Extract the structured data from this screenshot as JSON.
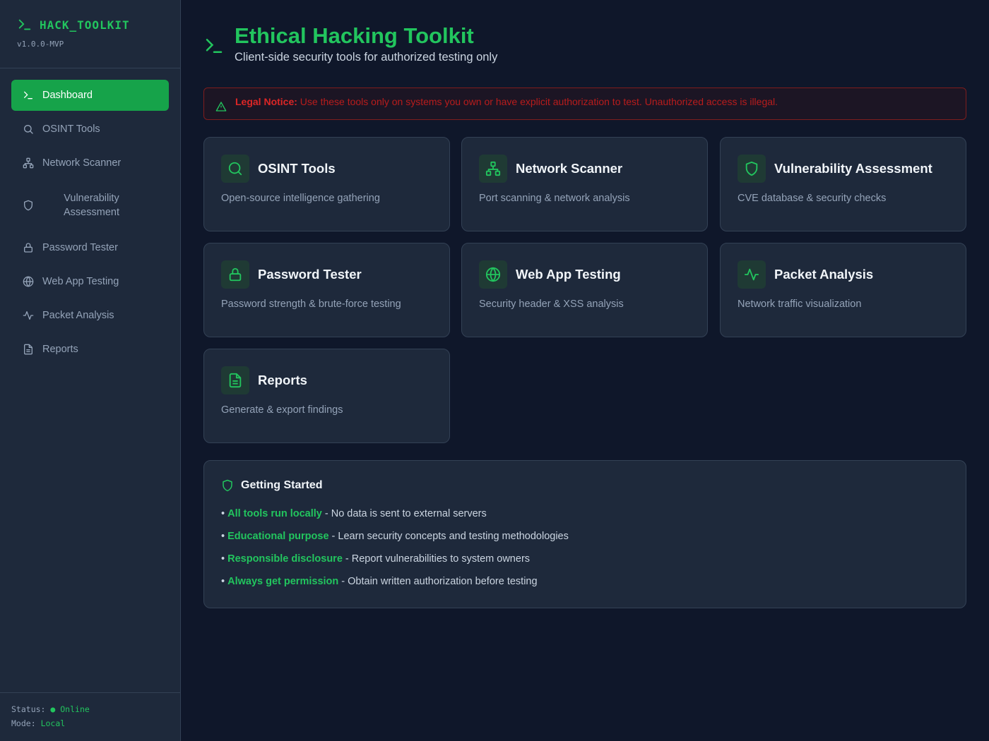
{
  "app": {
    "name": "HACK_TOOLKIT",
    "version": "v1.0.0-MVP"
  },
  "sidebar": {
    "items": [
      {
        "label": "Dashboard",
        "icon": "terminal-icon",
        "active": true
      },
      {
        "label": "OSINT Tools",
        "icon": "search-icon"
      },
      {
        "label": "Network Scanner",
        "icon": "network-icon"
      },
      {
        "label": "Vulnerability Assessment",
        "icon": "shield-icon"
      },
      {
        "label": "Password Tester",
        "icon": "lock-icon"
      },
      {
        "label": "Web App Testing",
        "icon": "globe-icon"
      },
      {
        "label": "Packet Analysis",
        "icon": "activity-icon"
      },
      {
        "label": "Reports",
        "icon": "file-icon"
      }
    ],
    "footer": {
      "status_label": "Status:",
      "status_value": "● Online",
      "mode_label": "Mode:",
      "mode_value": "Local"
    }
  },
  "header": {
    "title": "Ethical Hacking Toolkit",
    "subtitle": "Client-side security tools for authorized testing only"
  },
  "notice": {
    "label": "Legal Notice:",
    "text": "Use these tools only on systems you own or have explicit authorization to test. Unauthorized access is illegal."
  },
  "cards": [
    {
      "title": "OSINT Tools",
      "desc": "Open-source intelligence gathering",
      "icon": "search-icon"
    },
    {
      "title": "Network Scanner",
      "desc": "Port scanning & network analysis",
      "icon": "network-icon"
    },
    {
      "title": "Vulnerability Assessment",
      "desc": "CVE database & security checks",
      "icon": "shield-icon"
    },
    {
      "title": "Password Tester",
      "desc": "Password strength & brute-force testing",
      "icon": "lock-icon"
    },
    {
      "title": "Web App Testing",
      "desc": "Security header & XSS analysis",
      "icon": "globe-icon"
    },
    {
      "title": "Packet Analysis",
      "desc": "Network traffic visualization",
      "icon": "activity-icon"
    },
    {
      "title": "Reports",
      "desc": "Generate & export findings",
      "icon": "file-icon"
    }
  ],
  "getting_started": {
    "title": "Getting Started",
    "items": [
      {
        "bullet": "•",
        "em": "All tools run locally",
        "rest": " - No data is sent to external servers"
      },
      {
        "bullet": "•",
        "em": "Educational purpose",
        "rest": " - Learn security concepts and testing methodologies"
      },
      {
        "bullet": "•",
        "em": "Responsible disclosure",
        "rest": " - Report vulnerabilities to system owners"
      },
      {
        "bullet": "•",
        "em": "Always get permission",
        "rest": " - Obtain written authorization before testing"
      }
    ]
  },
  "colors": {
    "accent": "#22c55e",
    "active_bg": "#16a34a",
    "danger": "#dc2626",
    "bg": "#0f172a",
    "panel": "#1e293b"
  }
}
